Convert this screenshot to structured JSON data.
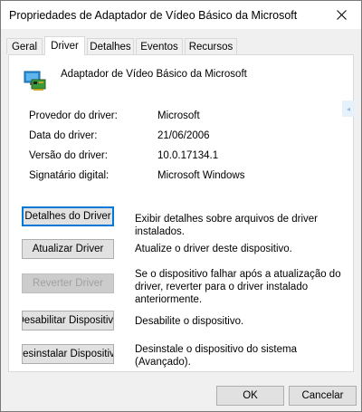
{
  "window": {
    "title": "Propriedades de Adaptador de Vídeo Básico da Microsoft",
    "close_icon": "close-icon"
  },
  "tabs": [
    {
      "label": "Geral",
      "active": false
    },
    {
      "label": "Driver",
      "active": true
    },
    {
      "label": "Detalhes",
      "active": false
    },
    {
      "label": "Eventos",
      "active": false
    },
    {
      "label": "Recursos",
      "active": false
    }
  ],
  "device": {
    "name": "Adaptador de Vídeo Básico da Microsoft",
    "icon": "display-adapter-icon"
  },
  "properties": [
    {
      "label": "Provedor do driver:",
      "value": "Microsoft"
    },
    {
      "label": "Data do driver:",
      "value": "21/06/2006"
    },
    {
      "label": "Versão do driver:",
      "value": "10.0.17134.1"
    },
    {
      "label": "Signatário digital:",
      "value": "Microsoft Windows"
    }
  ],
  "actions": [
    {
      "button": "Detalhes do Driver",
      "description": "Exibir detalhes sobre arquivos de driver instalados.",
      "enabled": true,
      "focused": true
    },
    {
      "button": "Atualizar Driver",
      "description": "Atualize o driver deste dispositivo.",
      "enabled": true,
      "focused": false
    },
    {
      "button": "Reverter Driver",
      "description": "Se o dispositivo falhar após a atualização do driver, reverter para o driver instalado anteriormente.",
      "enabled": false,
      "focused": false
    },
    {
      "button": "Desabilitar Dispositivo",
      "description": "Desabilite o dispositivo.",
      "enabled": true,
      "focused": false
    },
    {
      "button": "Desinstalar Dispositivo",
      "description": "Desinstale o dispositivo do sistema (Avançado).",
      "enabled": true,
      "focused": false
    }
  ],
  "footer": {
    "ok_label": "OK",
    "cancel_label": "Cancelar"
  },
  "colors": {
    "focus_border": "#0078d7",
    "button_face": "#e1e1e1",
    "disabled_text": "#a0a0a0"
  }
}
